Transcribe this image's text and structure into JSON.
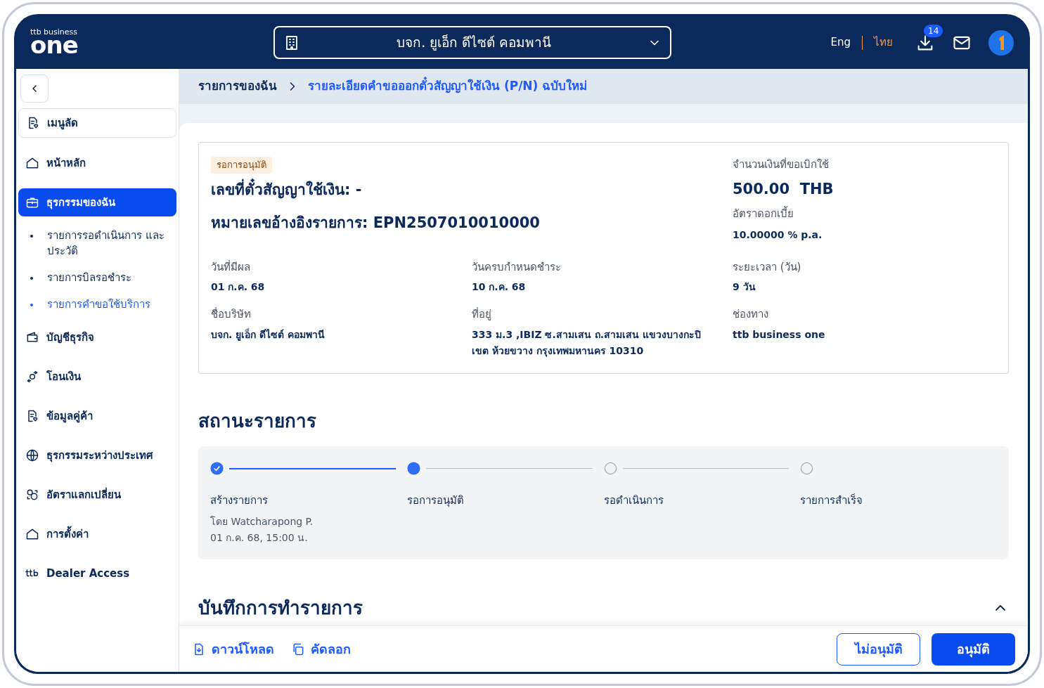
{
  "header": {
    "logo": {
      "brand": "ttb business",
      "word": "one"
    },
    "company_selector": {
      "value": "บจก. ยูเอ็ก ดีไซต์ คอมพานี"
    },
    "languages": [
      {
        "label": "Eng",
        "selected": false
      },
      {
        "label": "ไทย",
        "selected": true
      }
    ],
    "download_badge": "14"
  },
  "sidebar": {
    "items": [
      {
        "kind": "shortcut",
        "label": "เมนูลัด",
        "selected": false
      },
      {
        "kind": "item",
        "label": "หน้าหลัก",
        "selected": false
      },
      {
        "kind": "item",
        "label": "ธุรกรรมของฉัน",
        "selected": true,
        "children": [
          {
            "label": "รายการรอดำเนินการ และประวัติ",
            "selected": false
          },
          {
            "label": "รายการบิลรอชำระ",
            "selected": false
          },
          {
            "label": "รายการคำขอใช้บริการ",
            "selected": true
          }
        ]
      },
      {
        "kind": "item",
        "label": "บัญชีธุรกิจ",
        "selected": false
      },
      {
        "kind": "item",
        "label": "โอนเงิน",
        "selected": false
      },
      {
        "kind": "item",
        "label": "ข้อมูลคู่ค้า",
        "selected": false
      },
      {
        "kind": "item",
        "label": "ธุรกรรมระหว่างประเทศ",
        "selected": false
      },
      {
        "kind": "item",
        "label": "อัตราแลกเปลี่ยน",
        "selected": false
      },
      {
        "kind": "item",
        "label": "การตั้งค่า",
        "selected": false
      },
      {
        "kind": "item",
        "label": "Dealer Access",
        "selected": false
      }
    ]
  },
  "breadcrumb": [
    {
      "label": "รายการของฉัน",
      "current": false
    },
    {
      "label": "รายละเอียดคำขอออกตั๋วสัญญาใช้เงิน (P/N) ฉบับใหม่",
      "current": true
    }
  ],
  "summary": {
    "status_badge": "รอการอนุมัติ",
    "contract_no": "เลขที่ตั๋วสัญญาใช้เงิน: -",
    "reference": "หมายเลขอ้างอิงรายการ: EPN2507010010000",
    "amount_label": "จำนวนเงินที่ขอเบิกใช้",
    "amount": "500.00  THB",
    "rate_label": "อัตราดอกเบี้ย",
    "rate": "10.00000 % p.a.",
    "fields": [
      {
        "label": "วันที่มีผล",
        "value": "01 ก.ค. 68"
      },
      {
        "label": "วันครบกำหนดชำระ",
        "value": "10 ก.ค. 68"
      },
      {
        "label": "ระยะเวลา (วัน)",
        "value": "9 วัน"
      },
      {
        "label": "ชื่อบริษัท",
        "value": "บจก. ยูเอ็ก ดีไซต์ คอมพานี"
      },
      {
        "label": "ที่อยู่",
        "value": "333 ม.3 ,IBIZ ซ.สามเสน ถ.สามเสน แขวงบางกะปิ เขต ห้วยขวาง กรุงเทพมหานคร 10310"
      },
      {
        "label": "ช่องทาง",
        "value": "ttb business one"
      }
    ]
  },
  "status": {
    "title": "สถานะรายการ",
    "steps": [
      {
        "label": "สร้างรายการ",
        "completed": true,
        "selected": false,
        "details": [
          "โดย Watcharapong P.",
          "01 ก.ค. 68, 15:00 น."
        ]
      },
      {
        "label": "รอการอนุมัติ",
        "completed": false,
        "selected": true
      },
      {
        "label": "รอดำเนินการ",
        "completed": false,
        "selected": false
      },
      {
        "label": "รายการสำเร็จ",
        "completed": false,
        "selected": false
      }
    ]
  },
  "log": {
    "title": "บันทึกการทำรายการ",
    "expanded": true
  },
  "footer": {
    "download": "ดาวน์โหลด",
    "copy": "คัดลอก",
    "reject": "ไม่อนุมัติ",
    "approve": "อนุมัติ"
  }
}
